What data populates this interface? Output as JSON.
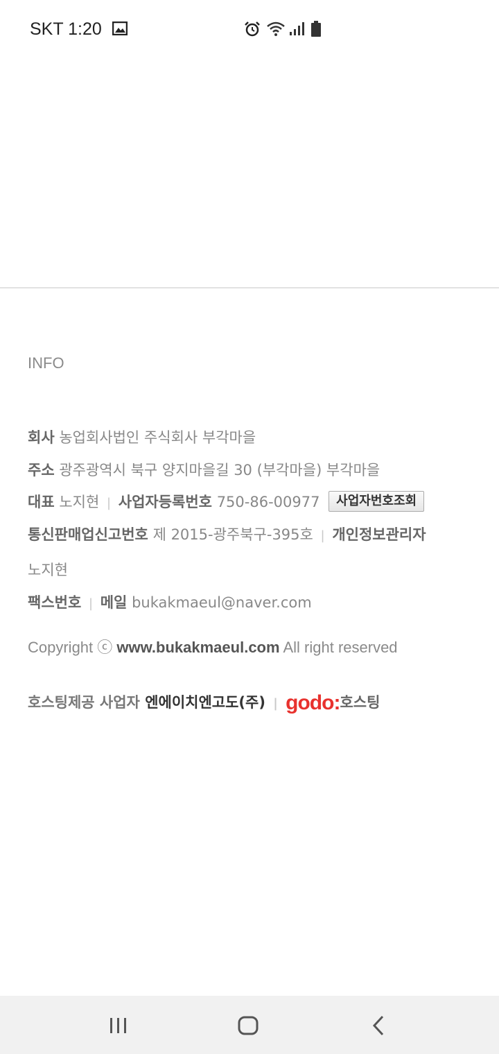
{
  "status_bar": {
    "carrier_time": "SKT 1:20",
    "icons": [
      "gallery-icon",
      "alarm-icon",
      "wifi-icon",
      "signal-icon",
      "battery-icon"
    ]
  },
  "footer": {
    "info_title": "INFO",
    "company_label": "회사",
    "company_value": "농업회사법인 주식회사 부각마을",
    "address_label": "주소",
    "address_value": "광주광역시 북구 양지마을길 30 (부각마을) 부각마을",
    "ceo_label": "대표",
    "ceo_value": "노지현",
    "bizno_label": "사업자등록번호",
    "bizno_value": "750-86-00977",
    "bizno_lookup_button": "사업자번호조회",
    "mailorder_label": "통신판매업신고번호",
    "mailorder_value": "제 2015-광주북구-395호",
    "privacy_label": "개인정보관리자",
    "privacy_value": "노지현",
    "fax_label": "팩스번호",
    "email_label": "메일",
    "email_value": "bukakmaeul@naver.com",
    "copyright_prefix": "Copyright ⓒ",
    "copyright_site": "www.bukakmaeul.com",
    "copyright_suffix": "All right reserved",
    "hosting_label": "호스팅제공 사업자",
    "hosting_company": "엔에이치엔고도(주)",
    "hosting_logo": "godo:",
    "hosting_logo_suffix": "호스팅"
  },
  "nav_bar": {
    "icons": [
      "recent-apps-icon",
      "home-icon",
      "back-icon"
    ]
  }
}
